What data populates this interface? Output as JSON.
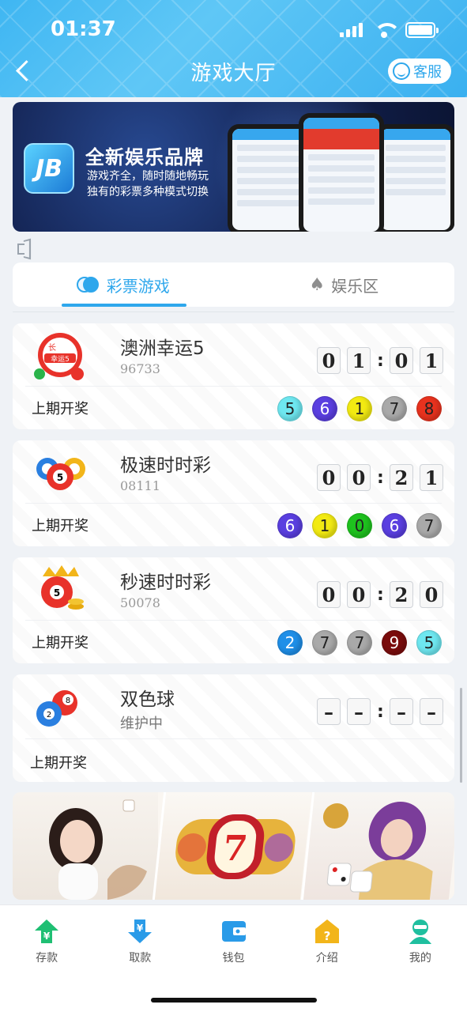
{
  "status_bar": {
    "time": "01:37"
  },
  "header": {
    "title": "游戏大厅",
    "service_label": "客服"
  },
  "banner": {
    "logo_text": "JB",
    "title": "全新娱乐品牌",
    "line1": "游戏齐全，随时随地畅玩",
    "line2": "独有的彩票多种模式切换"
  },
  "tabs": [
    {
      "label": "彩票游戏",
      "active": true
    },
    {
      "label": "娱乐区",
      "active": false
    }
  ],
  "games": [
    {
      "name": "澳洲幸运5",
      "issue": "96733",
      "timer": [
        "0",
        "1",
        "0",
        "1"
      ],
      "last_label": "上期开奖",
      "balls": [
        {
          "n": "5",
          "color": "#6ee7f0"
        },
        {
          "n": "6",
          "color": "#5a3fe0"
        },
        {
          "n": "1",
          "color": "#f2ea12"
        },
        {
          "n": "7",
          "color": "#a9a9a9"
        },
        {
          "n": "8",
          "color": "#e8321e"
        }
      ]
    },
    {
      "name": "极速时时彩",
      "issue": "08111",
      "timer": [
        "0",
        "0",
        "2",
        "1"
      ],
      "last_label": "上期开奖",
      "balls": [
        {
          "n": "6",
          "color": "#5a3fe0"
        },
        {
          "n": "1",
          "color": "#f2ea12"
        },
        {
          "n": "0",
          "color": "#1ec21e"
        },
        {
          "n": "6",
          "color": "#5a3fe0"
        },
        {
          "n": "7",
          "color": "#a9a9a9"
        }
      ]
    },
    {
      "name": "秒速时时彩",
      "issue": "50078",
      "timer": [
        "0",
        "0",
        "2",
        "0"
      ],
      "last_label": "上期开奖",
      "balls": [
        {
          "n": "2",
          "color": "#1f8fe8"
        },
        {
          "n": "7",
          "color": "#a9a9a9"
        },
        {
          "n": "7",
          "color": "#a9a9a9"
        },
        {
          "n": "9",
          "color": "#7a0c0c"
        },
        {
          "n": "5",
          "color": "#6ee7f0"
        }
      ]
    },
    {
      "name": "双色球",
      "issue": "维护中",
      "timer": [
        "–",
        "–",
        "–",
        "–"
      ],
      "last_label": "上期开奖",
      "balls": []
    }
  ],
  "nav": [
    {
      "label": "存款",
      "icon": "deposit-icon",
      "color": "#1fbf73"
    },
    {
      "label": "取款",
      "icon": "withdraw-icon",
      "color": "#2a9be8"
    },
    {
      "label": "钱包",
      "icon": "wallet-icon",
      "color": "#2a9be8"
    },
    {
      "label": "介绍",
      "icon": "intro-icon",
      "color": "#f2b51a"
    },
    {
      "label": "我的",
      "icon": "profile-icon",
      "color": "#1fbf9f"
    }
  ]
}
